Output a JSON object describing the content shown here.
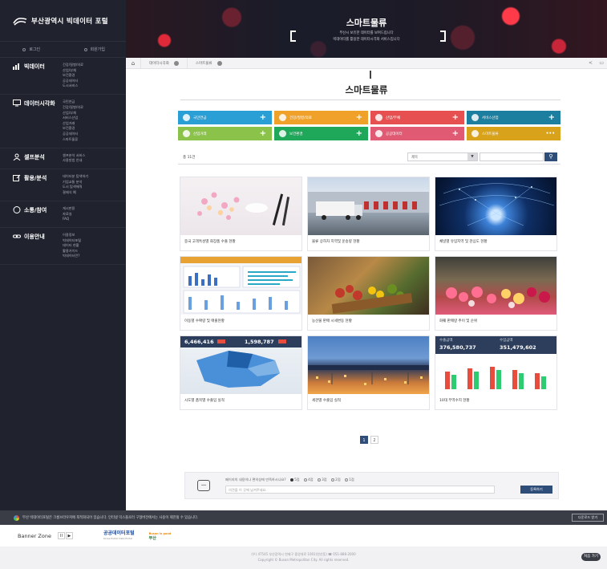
{
  "sidebar": {
    "logo_text": "부산광역시 빅데이터 포털",
    "login": "로그인",
    "signup": "회원가입",
    "sections": [
      {
        "label": "빅데이터",
        "icon": "bar-chart-icon",
        "items": [
          "건강/질병/의료",
          "산업/부채",
          "보건환경",
          "공공데이터",
          "도시서비스"
        ]
      },
      {
        "label": "데이터시각화",
        "icon": "monitor-icon",
        "items": [
          "국민연금",
          "건강/질병/의료",
          "산업/부채",
          "서비스산업",
          "산업거래",
          "보건환경",
          "공공데이터",
          "스마트물류"
        ]
      },
      {
        "label": "셀프분석",
        "icon": "person-icon",
        "items": [
          "셀프분석 서비스",
          "사용방법 안내"
        ]
      },
      {
        "label": "활용/분석",
        "icon": "edit-icon",
        "items": [
          "데이터분 탐색하기",
          "기업교통 분석",
          "도시 탐색해줘",
          "결제식 예"
        ]
      },
      {
        "label": "소통/참여",
        "icon": "chat-icon",
        "items": [
          "게시판용",
          "자료실",
          "FAQ"
        ]
      },
      {
        "label": "이용안내",
        "icon": "link-icon",
        "items": [
          "이용정보",
          "빅데이터포털",
          "데이터 현황",
          "활용가이드",
          "빅데이터란?"
        ]
      }
    ]
  },
  "hero": {
    "title": "스마트물류",
    "sub1": "부산시 보유한 데이터를 보여드립니다",
    "sub2": "빅데이터를 활용한 데이터시각화 서비스입니다"
  },
  "breadcrumb": {
    "items": [
      "데이터시각화",
      "스마트물류"
    ]
  },
  "page": {
    "title": "스마트물류"
  },
  "categories": [
    {
      "label": "국민연금",
      "color": "#2a9fd6"
    },
    {
      "label": "건강/질병/의료",
      "color": "#f0a12a"
    },
    {
      "label": "산업/부채",
      "color": "#e65050"
    },
    {
      "label": "서비스산업",
      "color": "#1d7fa0"
    },
    {
      "label": "산업거래",
      "color": "#8bc34a"
    },
    {
      "label": "보건환경",
      "color": "#1fa85a"
    },
    {
      "label": "공공데이터",
      "color": "#e05a73"
    },
    {
      "label": "스마트물류",
      "color": "#d8a21a"
    }
  ],
  "search": {
    "total": "총 11건",
    "select_value": "제목",
    "select_arrow": "▼",
    "button_glyph": "⚲"
  },
  "cards": [
    {
      "title": "중국 고객특성별 화장품 수출 현황"
    },
    {
      "title": "물류 상하차 지역및 운송량 현황"
    },
    {
      "title": "채널별 유입지역 및 관심도 현황"
    },
    {
      "title": "이동별 수확량 및 매출현황"
    },
    {
      "title": "농산물 판매 시세변동 현황"
    },
    {
      "title": "화훼 판매량 추이 및 순위"
    },
    {
      "title": "시도별 품목별 수출입 실적",
      "kpi1": "6,466,416",
      "kpi2": "1,598,787"
    },
    {
      "title": "세관별 수출입 실적"
    },
    {
      "title": "10대 무역수지 현황",
      "kpi1_label": "수출금액",
      "kpi1": "376,580,737",
      "kpi2_label": "수입금액",
      "kpi2": "351,479,602"
    }
  ],
  "pagination": {
    "pages": [
      "1",
      "2"
    ],
    "current": "1"
  },
  "feedback": {
    "question": "페이지의 내용이나 편의성에 만족하시나요?",
    "options": [
      "5점",
      "4점",
      "3점",
      "2점",
      "1점"
    ],
    "placeholder": "의견을 이 곳에 남겨주세요.",
    "send": "등록하기"
  },
  "notice": {
    "text": "부산 빅데이터포털은 크롬브라우저에 최적화되어 있습니다. 인터넷 익스플로러 구형버전에서는 사용이 제한될 수 있습니다.",
    "button": "다운로드 받기"
  },
  "banner": {
    "label": "Banner Zone",
    "prev": "II",
    "next": "▶",
    "logo1": "공공데이터포털",
    "logo1_sub": "Korea Public Data Portal",
    "logo2": "Busan is good",
    "logo2_sub": "부산"
  },
  "footer": {
    "address": "(우) 47545 부산광역시 연제구 중앙대로 1001(연산동) ☎ 051-888-2000",
    "copyright": "Copyright © Busan Metropolitan City. All rights reserved.",
    "top": "처음 가기"
  }
}
